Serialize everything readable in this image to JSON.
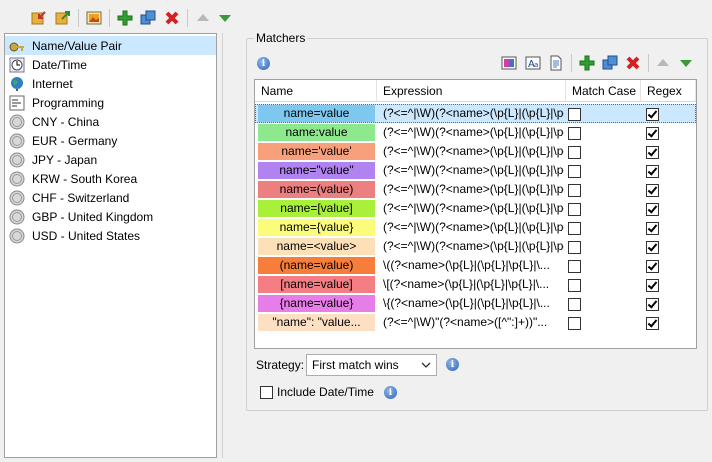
{
  "toolbar": {
    "icons": [
      "import-icon",
      "export-icon",
      "image-icon",
      "add-icon",
      "duplicate-icon",
      "delete-icon",
      "move-up-icon",
      "move-down-icon"
    ]
  },
  "left_list": {
    "items": [
      {
        "label": "Name/Value Pair",
        "icon": "key-icon",
        "selected": true
      },
      {
        "label": "Date/Time",
        "icon": "clock-icon"
      },
      {
        "label": "Internet",
        "icon": "globe-icon"
      },
      {
        "label": "Programming",
        "icon": "code-icon"
      },
      {
        "label": "CNY - China",
        "icon": "coin-icon"
      },
      {
        "label": "EUR - Germany",
        "icon": "coin-icon"
      },
      {
        "label": "JPY - Japan",
        "icon": "coin-icon"
      },
      {
        "label": "KRW - South Korea",
        "icon": "coin-icon"
      },
      {
        "label": "CHF - Switzerland",
        "icon": "coin-icon"
      },
      {
        "label": "GBP - United Kingdom",
        "icon": "coin-icon"
      },
      {
        "label": "USD - United States",
        "icon": "coin-icon"
      }
    ]
  },
  "matchers": {
    "title": "Matchers",
    "columns": [
      "Name",
      "Expression",
      "Match Case",
      "Regex"
    ],
    "rows": [
      {
        "name": "name=value",
        "expr": "(?<=^|\\W)(?<name>(\\p{L}|(\\p{L}|\\p{",
        "bg": "#7ec8f0",
        "match_case": false,
        "regex": true,
        "selected": true
      },
      {
        "name": "name:value",
        "expr": "(?<=^|\\W)(?<name>(\\p{L}|(\\p{L}|\\p{",
        "bg": "#8ee88e",
        "match_case": false,
        "regex": true
      },
      {
        "name": "name='value'",
        "expr": "(?<=^|\\W)(?<name>(\\p{L}|(\\p{L}|\\p{",
        "bg": "#f8a07c",
        "match_case": false,
        "regex": true
      },
      {
        "name": "name=\"value\"",
        "expr": "(?<=^|\\W)(?<name>(\\p{L}|(\\p{L}|\\p{",
        "bg": "#b083f0",
        "match_case": false,
        "regex": true
      },
      {
        "name": "name=(value)",
        "expr": "(?<=^|\\W)(?<name>(\\p{L}|(\\p{L}|\\p{",
        "bg": "#ec7f7f",
        "match_case": false,
        "regex": true
      },
      {
        "name": "name=[value]",
        "expr": "(?<=^|\\W)(?<name>(\\p{L}|(\\p{L}|\\p{",
        "bg": "#a8f03a",
        "match_case": false,
        "regex": true
      },
      {
        "name": "name={value}",
        "expr": "(?<=^|\\W)(?<name>(\\p{L}|(\\p{L}|\\p{",
        "bg": "#fbfb7c",
        "match_case": false,
        "regex": true
      },
      {
        "name": "name=<value>",
        "expr": "(?<=^|\\W)(?<name>(\\p{L}|(\\p{L}|\\p{",
        "bg": "#fde0b8",
        "match_case": false,
        "regex": true
      },
      {
        "name": "(name=value)",
        "expr": "\\((?<name>(\\p{L}|(\\p{L}|\\p{L}|\\...",
        "bg": "#f77e3a",
        "match_case": false,
        "regex": true
      },
      {
        "name": "[name=value]",
        "expr": "\\[(?<name>(\\p{L}|(\\p{L}|\\p{L}|\\...",
        "bg": "#f57e84",
        "match_case": false,
        "regex": true
      },
      {
        "name": "{name=value}",
        "expr": "\\{(?<name>(\\p{L}|(\\p{L}|\\p{L}|\\...",
        "bg": "#e77de9",
        "match_case": false,
        "regex": true
      },
      {
        "name": "\"name\": \"value...",
        "expr": "(?<=^|\\W)\"(?<name>([^\":]+))\"...",
        "bg": "#fde0c4",
        "match_case": false,
        "regex": true
      }
    ]
  },
  "strategy": {
    "label": "Strategy:",
    "value": "First match wins"
  },
  "include_date_time": {
    "label": "Include Date/Time",
    "checked": false
  }
}
